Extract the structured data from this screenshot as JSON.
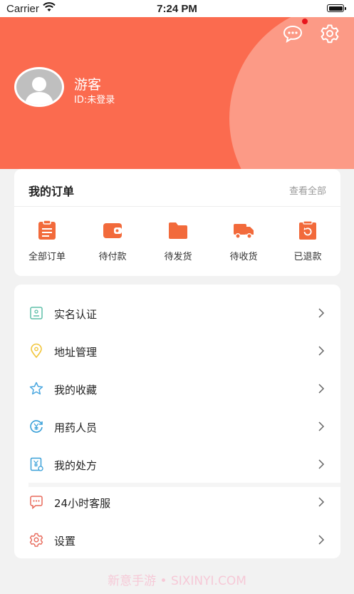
{
  "status_bar": {
    "carrier": "Carrier",
    "time": "7:24 PM"
  },
  "header": {
    "colors": {
      "background": "#fb6b4f",
      "circle": "#fc9a86",
      "badge": "#e8141c"
    },
    "message_icon": "chat-bubble-icon",
    "settings_icon": "gear-icon",
    "has_unread_badge": true,
    "user": {
      "name": "游客",
      "id_text": "ID:未登录"
    }
  },
  "orders": {
    "title": "我的订单",
    "view_all": "查看全部",
    "accent_color": "#f26a3b",
    "items": [
      {
        "label": "全部订单",
        "icon": "clipboard-icon"
      },
      {
        "label": "待付款",
        "icon": "wallet-icon"
      },
      {
        "label": "待发货",
        "icon": "folder-icon"
      },
      {
        "label": "待收货",
        "icon": "truck-icon"
      },
      {
        "label": "已退款",
        "icon": "refund-icon"
      }
    ]
  },
  "menu": {
    "items": [
      {
        "label": "实名认证",
        "icon": "id-card-icon"
      },
      {
        "label": "地址管理",
        "icon": "location-pin-icon"
      },
      {
        "label": "我的收藏",
        "icon": "star-icon"
      },
      {
        "label": "用药人员",
        "icon": "medicine-user-icon"
      },
      {
        "label": "我的处方",
        "icon": "prescription-icon"
      },
      {
        "label": "24小时客服",
        "icon": "customer-service-icon"
      },
      {
        "label": "设置",
        "icon": "settings-icon"
      }
    ]
  },
  "watermark": "新意手游 • SIXINYI.COM"
}
